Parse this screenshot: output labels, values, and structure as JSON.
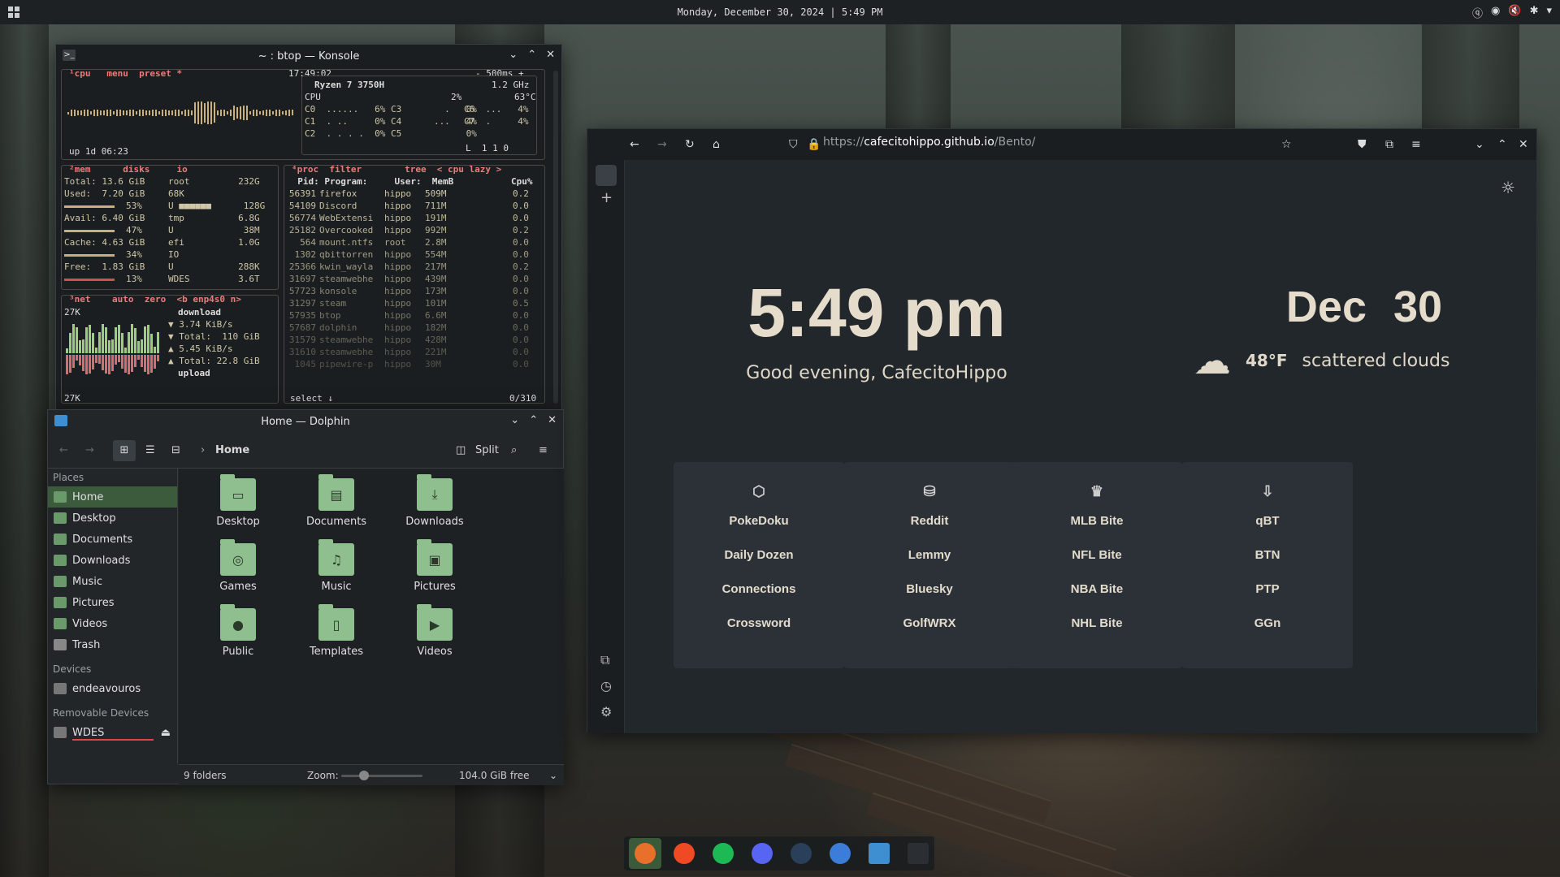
{
  "topbar": {
    "clock": "Monday, December 30, 2024 | 5:49 PM"
  },
  "konsole": {
    "title": "~ : btop — Konsole",
    "cpu_header": "¹cpu   menu  preset *",
    "time": "17:49:02",
    "interval": "- 500ms +",
    "cpu_model": "Ryzen 7 3750H",
    "freq": "1.2 GHz",
    "cpu_total": "CPU",
    "cpu_pct": "2%",
    "cpu_temp": "63°C",
    "cores_left": "C0  ......   6% C3        .   0%",
    "cores_mid": "C1  . ..     0% C4      ...   4%",
    "cores_low": "C2  . . . .  0% C5            0%",
    "cores_right": [
      "C6  ...   4%",
      "C7  .     4%"
    ],
    "load": "L  1 1 0",
    "uptime": "up 1d 06:23",
    "mem_header": "²mem      disks     io",
    "mem_lines": [
      "Total: 13.6 GiB",
      "Used:  7.20 GiB",
      "53%",
      "Avail: 6.40 GiB",
      "47%",
      "Cache: 4.63 GiB",
      "34%",
      "Free:  1.83 GiB",
      "13%"
    ],
    "disk_lines": [
      "root         232G",
      "68K",
      "U ■■■■■■      128G",
      "tmp          6.8G",
      "U             38M",
      "efi          1.0G",
      "IO",
      "U            288K",
      "WDES         3.6T"
    ],
    "proc_header": "⁴proc  filter        tree  < cpu lazy >",
    "proc_cols": "  Pid: Program:     User:  MemB",
    "proc_cpu_col": "Cpu%",
    "procs": [
      {
        "pid": "56391",
        "prog": "firefox",
        "user": "hippo",
        "mem": "509M",
        "cpu": "0.2"
      },
      {
        "pid": "54109",
        "prog": "Discord",
        "user": "hippo",
        "mem": "711M",
        "cpu": "0.0"
      },
      {
        "pid": "56774",
        "prog": "WebExtensi",
        "user": "hippo",
        "mem": "191M",
        "cpu": "0.0"
      },
      {
        "pid": "25182",
        "prog": "Overcooked",
        "user": "hippo",
        "mem": "992M",
        "cpu": "0.2"
      },
      {
        "pid": "564",
        "prog": "mount.ntfs",
        "user": "root",
        "mem": "2.8M",
        "cpu": "0.0"
      },
      {
        "pid": "1302",
        "prog": "qbittorren",
        "user": "hippo",
        "mem": "554M",
        "cpu": "0.0"
      },
      {
        "pid": "25366",
        "prog": "kwin_wayla",
        "user": "hippo",
        "mem": "217M",
        "cpu": "0.2"
      },
      {
        "pid": "31697",
        "prog": "steamwebhe",
        "user": "hippo",
        "mem": "439M",
        "cpu": "0.0"
      },
      {
        "pid": "57723",
        "prog": "konsole",
        "user": "hippo",
        "mem": "173M",
        "cpu": "0.0"
      },
      {
        "pid": "31297",
        "prog": "steam",
        "user": "hippo",
        "mem": "101M",
        "cpu": "0.5"
      },
      {
        "pid": "57935",
        "prog": "btop",
        "user": "hippo",
        "mem": "6.6M",
        "cpu": "0.0"
      },
      {
        "pid": "57687",
        "prog": "dolphin",
        "user": "hippo",
        "mem": "182M",
        "cpu": "0.0"
      },
      {
        "pid": "31579",
        "prog": "steamwebhe",
        "user": "hippo",
        "mem": "428M",
        "cpu": "0.0"
      },
      {
        "pid": "31610",
        "prog": "steamwebhe",
        "user": "hippo",
        "mem": "221M",
        "cpu": "0.0"
      },
      {
        "pid": "1045",
        "prog": "pipewire-p",
        "user": "hippo",
        "mem": "30M",
        "cpu": "0.0"
      }
    ],
    "proc_footer_left": "select ↓",
    "proc_footer_right": "0/310",
    "net_header": "³net    auto  zero  <b enp4s0 n>",
    "net_top": "27K",
    "net_bottom": "27K",
    "net_lines": [
      "download",
      "▼ 3.74 KiB/s",
      "▼ Total:  110 GiB",
      "▲ 5.45 KiB/s",
      "▲ Total: 22.8 GiB",
      "upload"
    ]
  },
  "dolphin": {
    "title": "Home — Dolphin",
    "breadcrumb": "Home",
    "split_label": "Split",
    "places_label": "Places",
    "places": [
      "Home",
      "Desktop",
      "Documents",
      "Downloads",
      "Music",
      "Pictures",
      "Videos",
      "Trash"
    ],
    "devices_label": "Devices",
    "devices": [
      "endeavouros"
    ],
    "removable_label": "Removable Devices",
    "removable": [
      "WDES"
    ],
    "folders": [
      {
        "name": "Desktop",
        "icon": "desktop-icon"
      },
      {
        "name": "Documents",
        "icon": "document-icon"
      },
      {
        "name": "Downloads",
        "icon": "download-icon"
      },
      {
        "name": "Games",
        "icon": "gamepad-icon"
      },
      {
        "name": "Music",
        "icon": "music-note-icon"
      },
      {
        "name": "Pictures",
        "icon": "picture-icon"
      },
      {
        "name": "Public",
        "icon": "person-icon"
      },
      {
        "name": "Templates",
        "icon": "template-icon"
      },
      {
        "name": "Videos",
        "icon": "video-icon"
      }
    ],
    "status_count": "9 folders",
    "zoom_label": "Zoom:",
    "free_space": "104.0 GiB free"
  },
  "browser": {
    "url_prefix": "https://",
    "url_host": "cafecitohippo.github.io",
    "url_path": "/Bento/",
    "time": "5:49 pm",
    "greeting": "Good evening, CafecitoHippo",
    "date_month": "Dec",
    "date_day": "30",
    "temp": "48°F",
    "conditions": "scattered clouds",
    "cards": [
      {
        "icon": "dice-icon",
        "links": [
          "PokeDoku",
          "Daily Dozen",
          "Connections",
          "Crossword"
        ]
      },
      {
        "icon": "stack-icon",
        "links": [
          "Reddit",
          "Lemmy",
          "Bluesky",
          "GolfWRX"
        ]
      },
      {
        "icon": "trophy-icon",
        "links": [
          "MLB Bite",
          "NFL Bite",
          "NBA Bite",
          "NHL Bite"
        ]
      },
      {
        "icon": "download-arrow-icon",
        "links": [
          "qBT",
          "BTN",
          "PTP",
          "GGn"
        ]
      }
    ]
  },
  "dock": [
    {
      "name": "firefox",
      "color": "#e8702a"
    },
    {
      "name": "brave",
      "color": "#f04a24"
    },
    {
      "name": "spotify",
      "color": "#1db954"
    },
    {
      "name": "discord",
      "color": "#5865f2"
    },
    {
      "name": "steam",
      "color": "#2a3f5a"
    },
    {
      "name": "qbittorrent",
      "color": "#3b7dd8"
    },
    {
      "name": "dolphin",
      "color": "#3d8fd1"
    },
    {
      "name": "konsole",
      "color": "#2b2f33"
    }
  ],
  "colors": {
    "accent": "#e6dccb",
    "konsole_header": "#ee7a7a",
    "folder": "#8fbf8f"
  }
}
